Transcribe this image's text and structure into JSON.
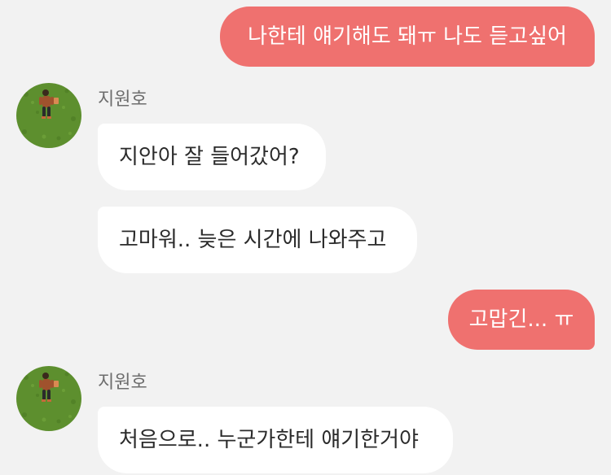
{
  "chat": {
    "messages": [
      {
        "type": "outgoing",
        "text": "나한테 얘기해도 돼ㅠ 나도 듣고싶어"
      },
      {
        "type": "sender",
        "name": "지원호"
      },
      {
        "type": "incoming",
        "text": "지안아 잘 들어갔어?"
      },
      {
        "type": "incoming",
        "text": "고마워.. 늦은 시간에 나와주고"
      },
      {
        "type": "outgoing",
        "text": "고맙긴... ㅠ"
      },
      {
        "type": "sender",
        "name": "지원호"
      },
      {
        "type": "incoming",
        "text": "처음으로.. 누군가한테 얘기한거야"
      }
    ]
  },
  "colors": {
    "background": "#f2f2f2",
    "outgoing_bubble": "#ef716f",
    "incoming_bubble": "#ffffff",
    "sender_name": "#6d6d6d"
  },
  "avatar": {
    "icon": "person-lying-on-grass-photo"
  }
}
